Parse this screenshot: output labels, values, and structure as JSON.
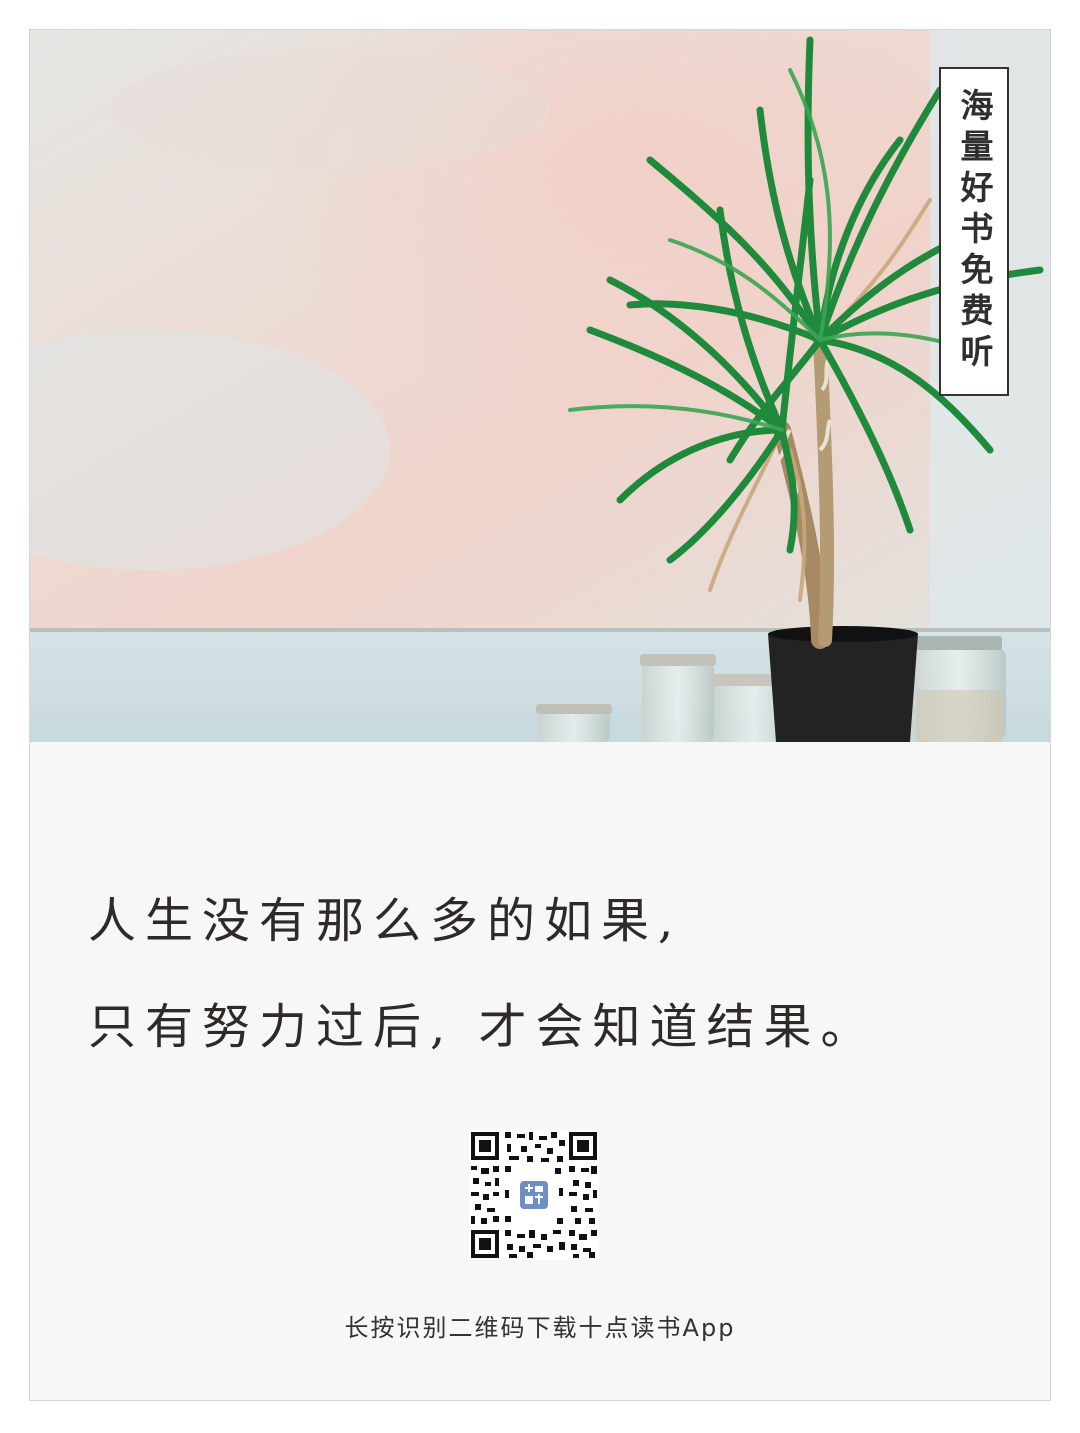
{
  "badge": {
    "text": "海量好书免费听"
  },
  "quote": {
    "line1": "人生没有那么多的如果,",
    "line2": "只有努力过后, 才会知道结果。"
  },
  "qr": {
    "center_logo_text": "十点读书"
  },
  "footer": {
    "caption": "长按识别二维码下载十点读书App"
  },
  "colors": {
    "plant_green": "#1f8a3c",
    "wall_pink": "#f1d4cc",
    "pot": "#222222",
    "qr_logo": "#6f8fc4"
  }
}
